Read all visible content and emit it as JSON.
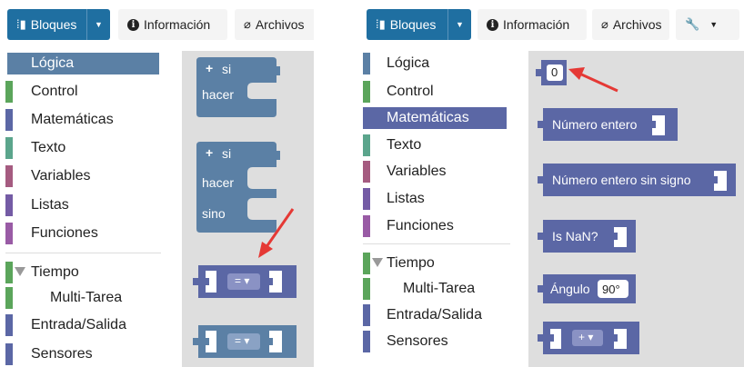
{
  "left": {
    "toolbar": {
      "bloques_label": "Bloques",
      "info_label": "Información",
      "archivos_label": "Archivos"
    },
    "categories": [
      {
        "label": "Lógica",
        "color": "#5b80a5"
      },
      {
        "label": "Control",
        "color": "#5ba55b"
      },
      {
        "label": "Matemáticas",
        "color": "#5b67a5"
      },
      {
        "label": "Texto",
        "color": "#5ba58c"
      },
      {
        "label": "Variables",
        "color": "#a55b80"
      },
      {
        "label": "Listas",
        "color": "#745ba5"
      },
      {
        "label": "Funciones",
        "color": "#995ba5"
      },
      {
        "label": "Tiempo",
        "color": "#5ba55b"
      },
      {
        "label": "Multi-Tarea",
        "color": "#5ba55b"
      },
      {
        "label": "Entrada/Salida",
        "color": "#5b67a5"
      },
      {
        "label": "Sensores",
        "color": "#5b67a5"
      }
    ],
    "selected": "Lógica",
    "blocks": {
      "if1": {
        "plus": "+",
        "si": "si",
        "hacer": "hacer"
      },
      "if2": {
        "plus": "+",
        "si": "si",
        "hacer": "hacer",
        "sino": "sino"
      },
      "compare": {
        "op": "= ▾"
      },
      "compare2": {
        "op": "= ▾"
      }
    }
  },
  "right": {
    "toolbar": {
      "bloques_label": "Bloques",
      "info_label": "Información",
      "archivos_label": "Archivos",
      "wrench_icon": "wrench-icon"
    },
    "categories": [
      {
        "label": "Lógica",
        "color": "#5b80a5"
      },
      {
        "label": "Control",
        "color": "#5ba55b"
      },
      {
        "label": "Matemáticas",
        "color": "#5b67a5"
      },
      {
        "label": "Texto",
        "color": "#5ba58c"
      },
      {
        "label": "Variables",
        "color": "#a55b80"
      },
      {
        "label": "Listas",
        "color": "#745ba5"
      },
      {
        "label": "Funciones",
        "color": "#995ba5"
      },
      {
        "label": "Tiempo",
        "color": "#5ba55b"
      },
      {
        "label": "Multi-Tarea",
        "color": "#5ba55b"
      },
      {
        "label": "Entrada/Salida",
        "color": "#5b67a5"
      },
      {
        "label": "Sensores",
        "color": "#5b67a5"
      }
    ],
    "selected": "Matemáticas",
    "blocks": {
      "number": {
        "value": "0"
      },
      "int": {
        "label": "Número entero"
      },
      "uint": {
        "label": "Número entero sin signo"
      },
      "isnan": {
        "label": "Is NaN?"
      },
      "angle": {
        "label": "Ángulo",
        "value": "90°"
      },
      "arith": {
        "op": "+ ▾"
      }
    }
  },
  "colors": {
    "toolbar_blue": "#1f6fa1",
    "logic_block": "#5b80a5",
    "math_block": "#5b67a5",
    "arrow": "#e53935"
  }
}
